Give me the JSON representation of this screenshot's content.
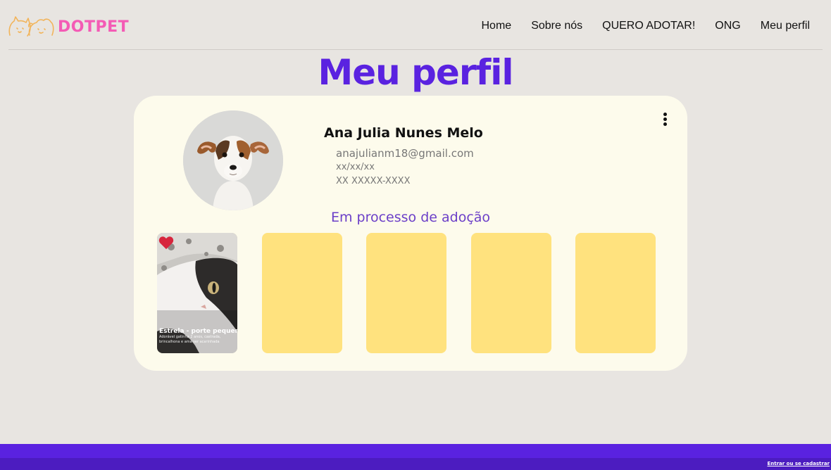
{
  "brand": {
    "name": "DOTPET",
    "color": "#f45bb5",
    "icon": "cat-dog-outline-icon"
  },
  "nav": {
    "items": [
      {
        "label": "Home"
      },
      {
        "label": "Sobre nós"
      },
      {
        "label": "QUERO ADOTAR!"
      },
      {
        "label": "ONG"
      },
      {
        "label": "Meu perfil"
      }
    ]
  },
  "page": {
    "title": "Meu perfil",
    "title_color": "#5a22e0"
  },
  "profile": {
    "name": "Ana Julia Nunes Melo",
    "email": "anajulianm18@gmail.com",
    "birthdate": "xx/xx/xx",
    "phone": "XX XXXXX-XXXX",
    "avatar": "dog-photo",
    "menu_icon": "vertical-dots-icon"
  },
  "adoption": {
    "section_title": "Em processo de adoção",
    "pets": [
      {
        "name": "Estrela - porte pequeno",
        "description": "Adorável gatinha 2 anos, castrada, brincalhona e ama ser acarinhada",
        "photo": "cat-photo",
        "favorite_icon": "heart-icon",
        "favorite_color": "#d7263d"
      }
    ],
    "placeholder_color": "#ffe27e"
  },
  "footer": {
    "link_label": "Entrar ou se cadastrar",
    "color": "#5a22e0"
  }
}
